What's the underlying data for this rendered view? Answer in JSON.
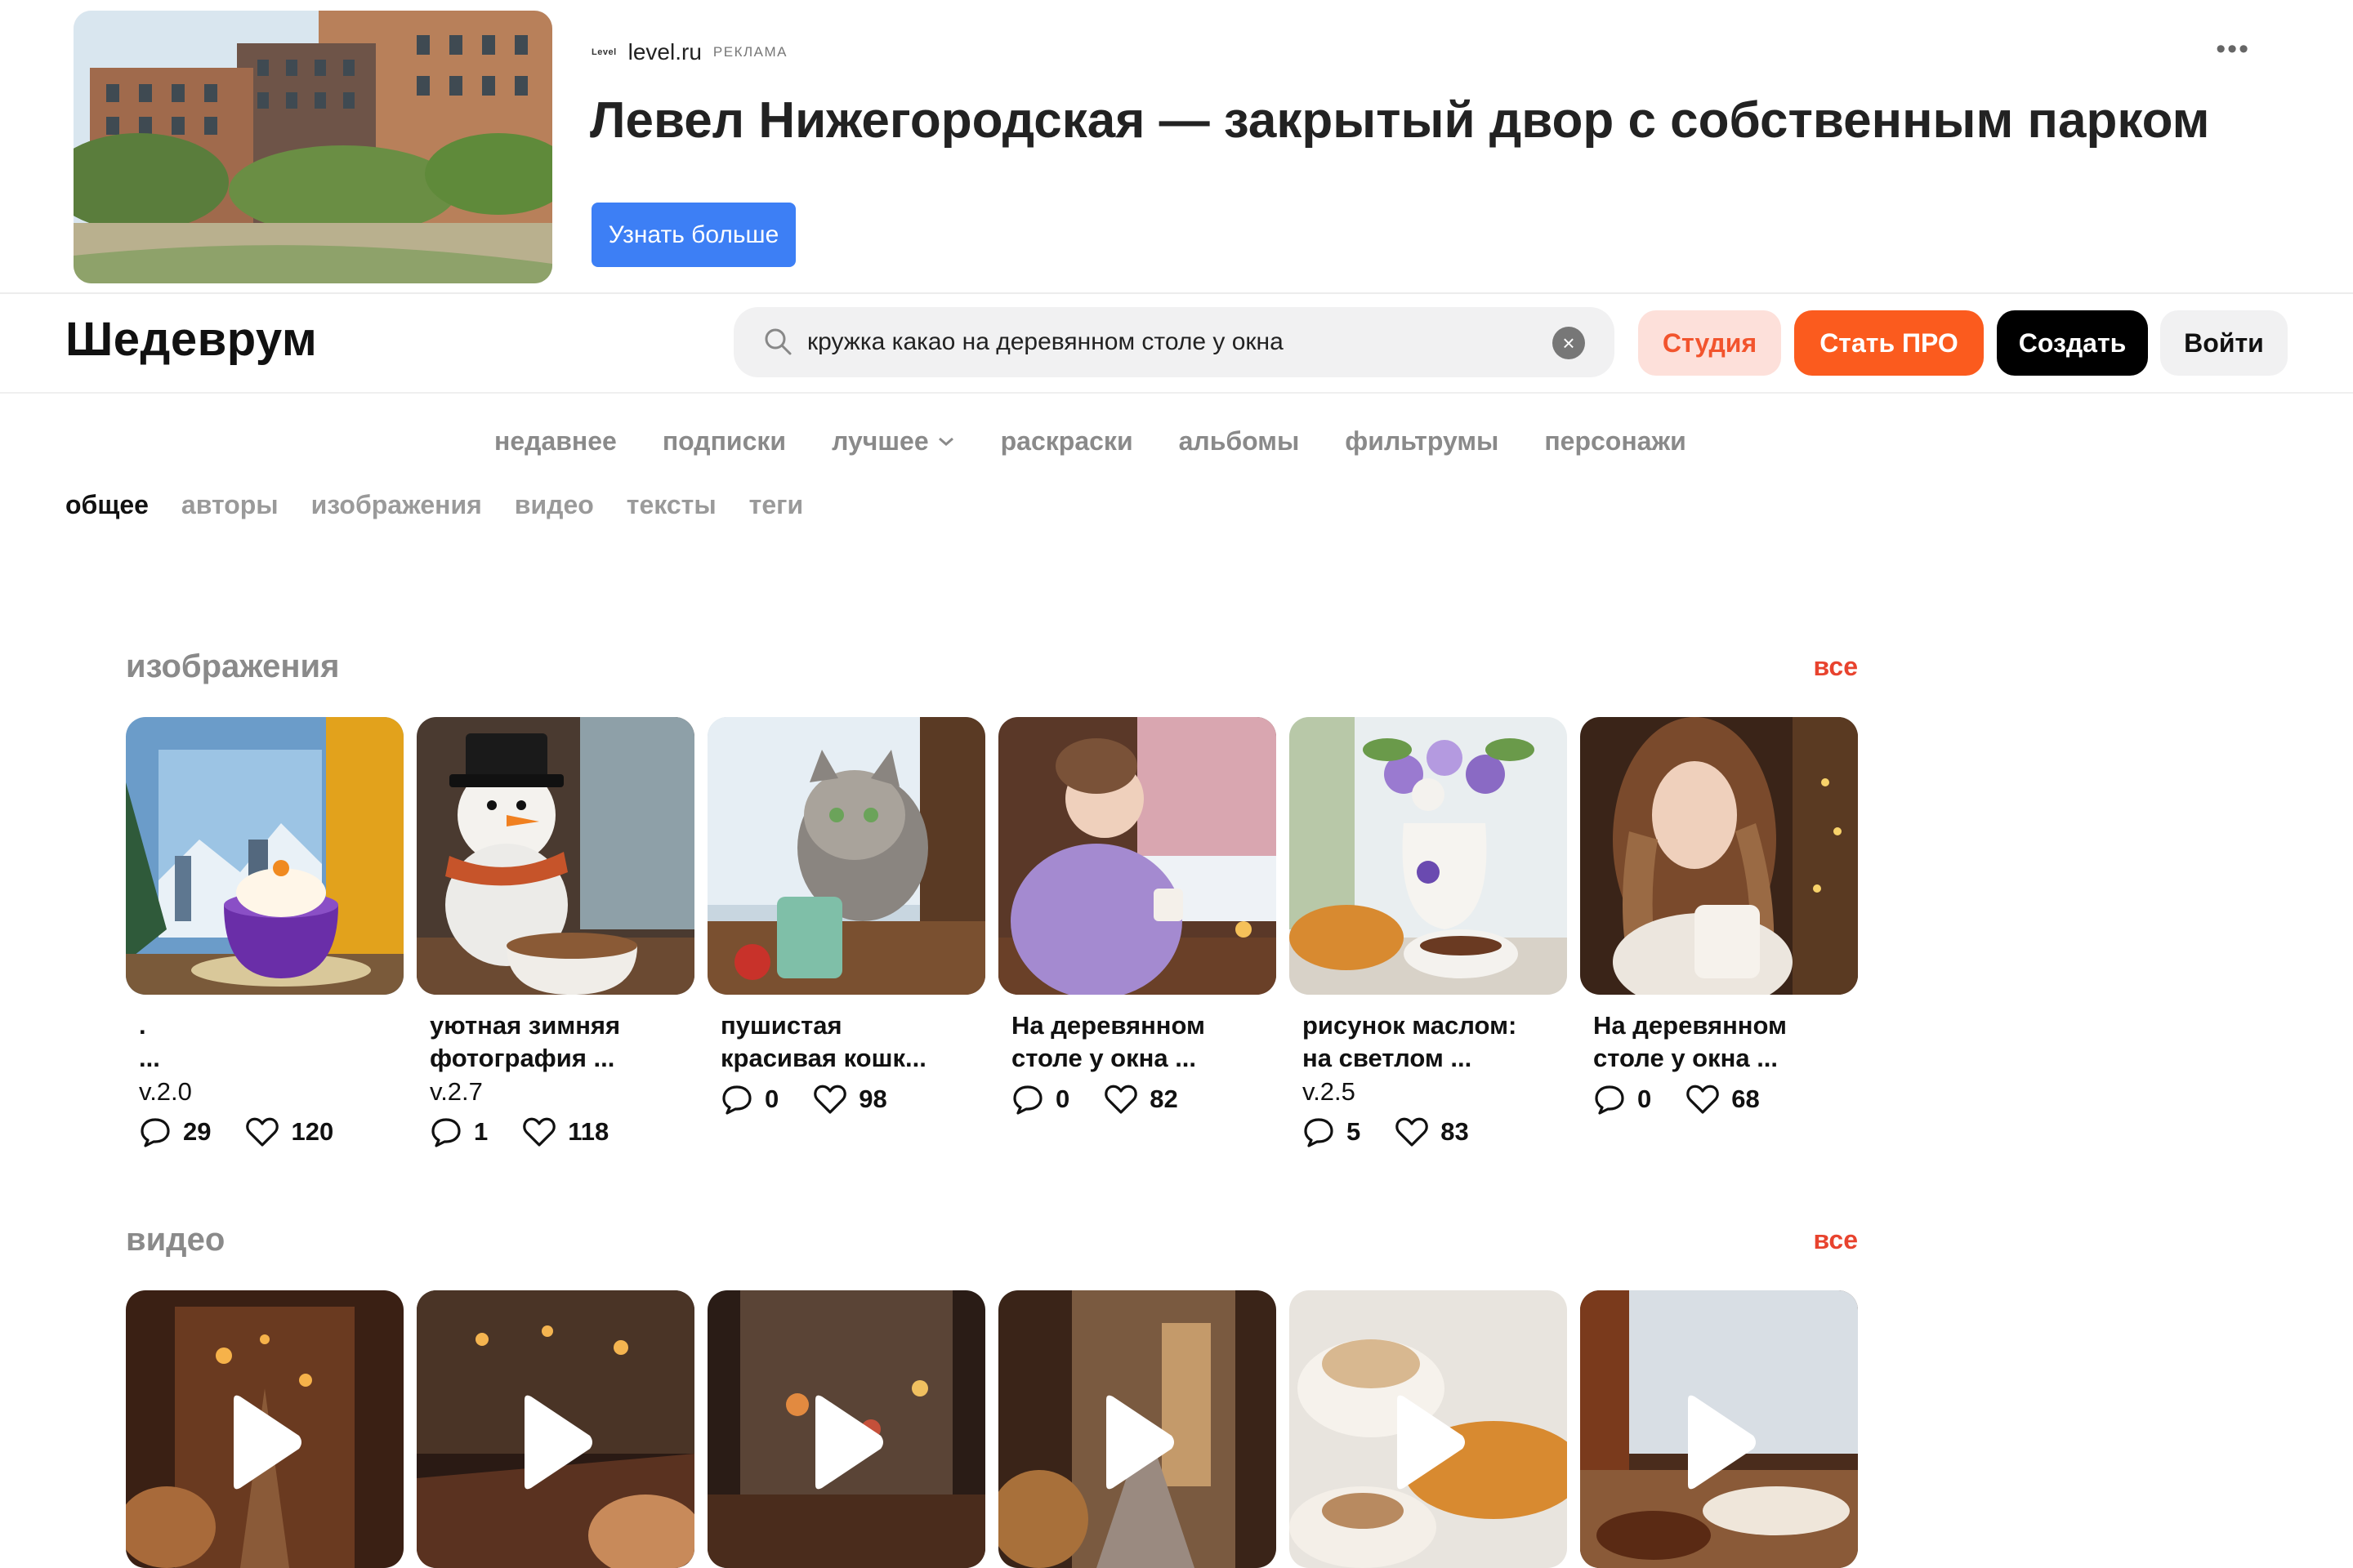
{
  "ad": {
    "logo": "Level",
    "domain": "level.ru",
    "label": "реклама",
    "title": "Левел Нижегородская — закрытый двор с собственным парком",
    "button": "Узнать больше",
    "more_icon": "more-dots-icon"
  },
  "header": {
    "logo": "Шедеврум",
    "search_value": "кружка какао на деревянном столе у окна",
    "buttons": {
      "studio": "Студия",
      "pro": "Стать ПРО",
      "create": "Создать",
      "login": "Войти"
    }
  },
  "nav": [
    "недавнее",
    "подписки",
    "лучшее",
    "раскраски",
    "альбомы",
    "фильтрумы",
    "персонажи"
  ],
  "subnav": {
    "active": "общее",
    "items": [
      "общее",
      "авторы",
      "изображения",
      "видео",
      "тексты",
      "теги"
    ]
  },
  "images_section": {
    "title": "изображения",
    "all": "все",
    "cards": [
      {
        "title_line1": ".",
        "title_line2": "...",
        "version": "v.2.0",
        "comments": "29",
        "likes": "120"
      },
      {
        "title_line1": "уютная зимняя",
        "title_line2": "фотография ...",
        "version": "v.2.7",
        "comments": "1",
        "likes": "118"
      },
      {
        "title_line1": "пушистая",
        "title_line2": "красивая кошк...",
        "version": "",
        "comments": "0",
        "likes": "98"
      },
      {
        "title_line1": "На деревянном",
        "title_line2": "столе у окна ...",
        "version": "",
        "comments": "0",
        "likes": "82"
      },
      {
        "title_line1": "рисунок маслом:",
        "title_line2": "на светлом ...",
        "version": "v.2.5",
        "comments": "5",
        "likes": "83"
      },
      {
        "title_line1": "На деревянном",
        "title_line2": "столе у окна ...",
        "version": "",
        "comments": "0",
        "likes": "68"
      }
    ]
  },
  "video_section": {
    "title": "видео",
    "all": "все",
    "count": 6
  },
  "colors": {
    "accent": "#e8432e",
    "pro": "#fb5b1e",
    "studio_bg": "#fde0da",
    "ad_button": "#3d7ff5"
  }
}
